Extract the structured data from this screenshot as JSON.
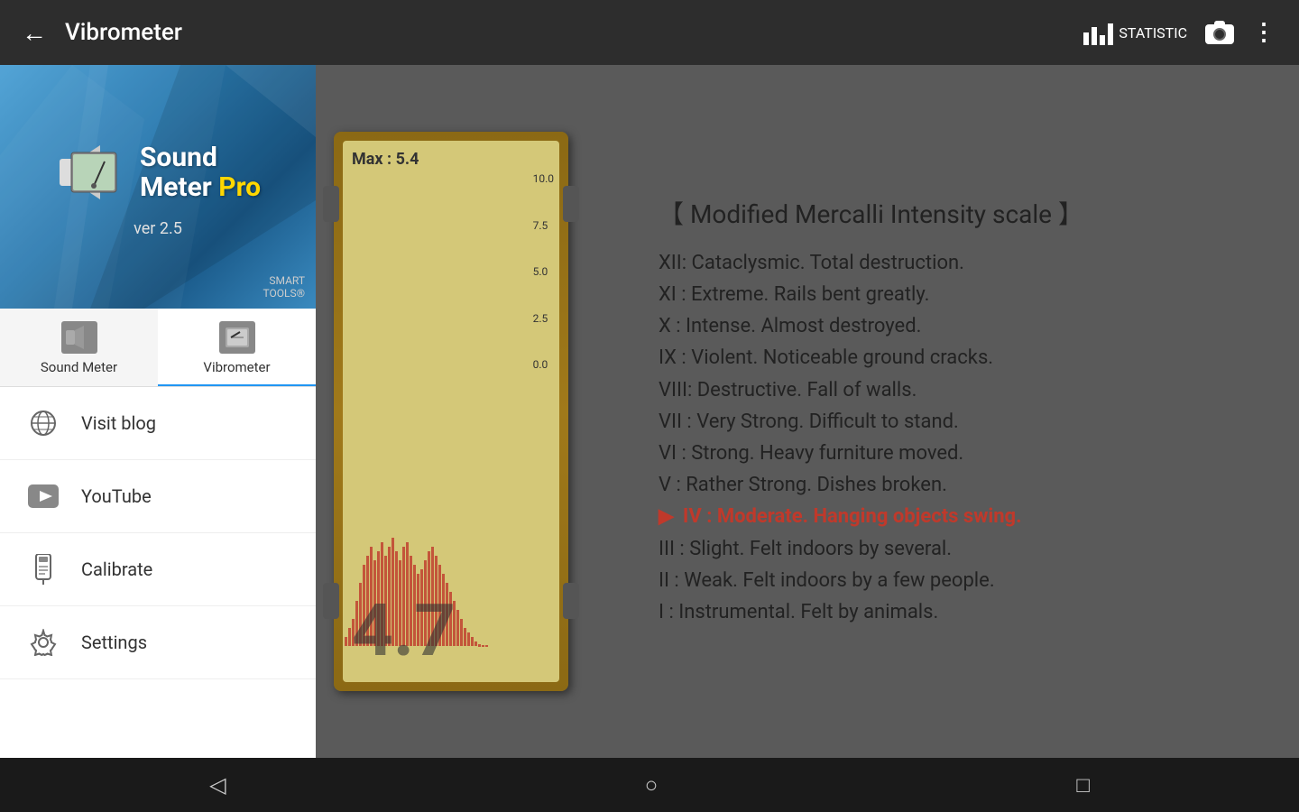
{
  "header": {
    "back_label": "←",
    "title": "Vibrometer",
    "statistic_label": "STATISTIC",
    "camera_label": "📷",
    "more_label": "⋮"
  },
  "sidebar": {
    "banner": {
      "app_name_line1": "Sound",
      "app_name_line2": "Meter",
      "app_name_pro": "Pro",
      "version": "ver 2.5",
      "brand": "SMART\nTOOLS®"
    },
    "tabs": [
      {
        "id": "sound-meter",
        "label": "Sound Meter",
        "active": false
      },
      {
        "id": "vibrometer",
        "label": "Vibrometer",
        "active": true
      }
    ],
    "menu_items": [
      {
        "id": "visit-blog",
        "label": "Visit blog",
        "icon": "globe"
      },
      {
        "id": "youtube",
        "label": "YouTube",
        "icon": "youtube"
      },
      {
        "id": "calibrate",
        "label": "Calibrate",
        "icon": "phone-cal"
      },
      {
        "id": "settings",
        "label": "Settings",
        "icon": "gear"
      }
    ]
  },
  "vibrometer": {
    "max_label": "Max : 5.4",
    "scale": [
      "10.0",
      "7.5",
      "5.0",
      "2.5",
      "0.0"
    ],
    "big_number": "4.7"
  },
  "mercalli": {
    "title": "【 Modified Mercalli Intensity scale 】",
    "items": [
      {
        "id": "xii",
        "text": "XII: Cataclysmic. Total destruction.",
        "active": false
      },
      {
        "id": "xi",
        "text": "XI : Extreme. Rails bent greatly.",
        "active": false
      },
      {
        "id": "x",
        "text": "X  : Intense. Almost destroyed.",
        "active": false
      },
      {
        "id": "ix",
        "text": "IX : Violent. Noticeable ground cracks.",
        "active": false
      },
      {
        "id": "viii",
        "text": "VIII: Destructive. Fall of walls.",
        "active": false
      },
      {
        "id": "vii",
        "text": "VII : Very Strong. Difficult to stand.",
        "active": false
      },
      {
        "id": "vi",
        "text": "VI : Strong. Heavy furniture moved.",
        "active": false
      },
      {
        "id": "v",
        "text": "V  : Rather Strong. Dishes broken.",
        "active": false
      },
      {
        "id": "iv",
        "text": "IV : Moderate. Hanging objects swing.",
        "active": true
      },
      {
        "id": "iii",
        "text": "III : Slight. Felt indoors by several.",
        "active": false
      },
      {
        "id": "ii",
        "text": "II : Weak. Felt indoors by a few people.",
        "active": false
      },
      {
        "id": "i",
        "text": "I  : Instrumental. Felt by animals.",
        "active": false
      }
    ]
  },
  "bottom_nav": {
    "back_label": "◁",
    "home_label": "○",
    "recent_label": "□"
  }
}
